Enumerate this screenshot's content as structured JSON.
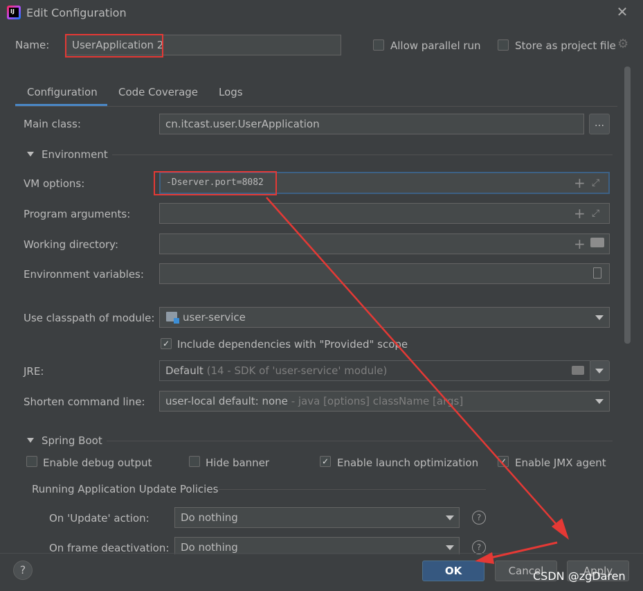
{
  "window": {
    "title": "Edit Configuration"
  },
  "name_row": {
    "label": "Name:",
    "value": "UserApplication 2",
    "allow_parallel_run": "Allow parallel run",
    "store_as_project_file": "Store as project file"
  },
  "tabs": [
    {
      "label": "Configuration",
      "selected": true
    },
    {
      "label": "Code Coverage"
    },
    {
      "label": "Logs"
    }
  ],
  "main_class": {
    "label": "Main class:",
    "value": "cn.itcast.user.UserApplication",
    "browse": "..."
  },
  "environment": {
    "section_title": "Environment",
    "vm_options": {
      "label": "VM options:",
      "value": "-Dserver.port=8082"
    },
    "program_arguments": {
      "label": "Program arguments:"
    },
    "working_directory": {
      "label": "Working directory:"
    },
    "environment_variables": {
      "label": "Environment variables:"
    },
    "classpath_module": {
      "label": "Use classpath of module:",
      "value": "user-service"
    },
    "include_dependencies": {
      "label": "Include dependencies with \"Provided\" scope",
      "checked": true
    },
    "jre": {
      "label": "JRE:",
      "value": "Default",
      "hint": "(14 - SDK of 'user-service' module)"
    },
    "shorten_command_line": {
      "label": "Shorten command line:",
      "value": "user-local default: none",
      "hint": "- java [options] className [args]"
    }
  },
  "spring_boot": {
    "section_title": "Spring Boot",
    "enable_debug_output": {
      "label": "Enable debug output",
      "checked": false
    },
    "hide_banner": {
      "label": "Hide banner",
      "checked": false
    },
    "enable_launch_optimization": {
      "label": "Enable launch optimization",
      "checked": true
    },
    "enable_jmx_agent": {
      "label": "Enable JMX agent",
      "checked": true
    },
    "policies_title": "Running Application Update Policies",
    "on_update": {
      "label": "On 'Update' action:",
      "value": "Do nothing"
    },
    "on_frame_deactivation": {
      "label": "On frame deactivation:",
      "value": "Do nothing"
    }
  },
  "buttons": {
    "ok": "OK",
    "cancel": "Cancel",
    "apply": "Apply",
    "help": "?"
  },
  "watermark": "CSDN @zgDaren",
  "colors": {
    "background": "#3c3f41",
    "field": "#45494a",
    "accent": "#4a88c7",
    "highlight_red": "#e53935",
    "ok_button": "#365880"
  }
}
